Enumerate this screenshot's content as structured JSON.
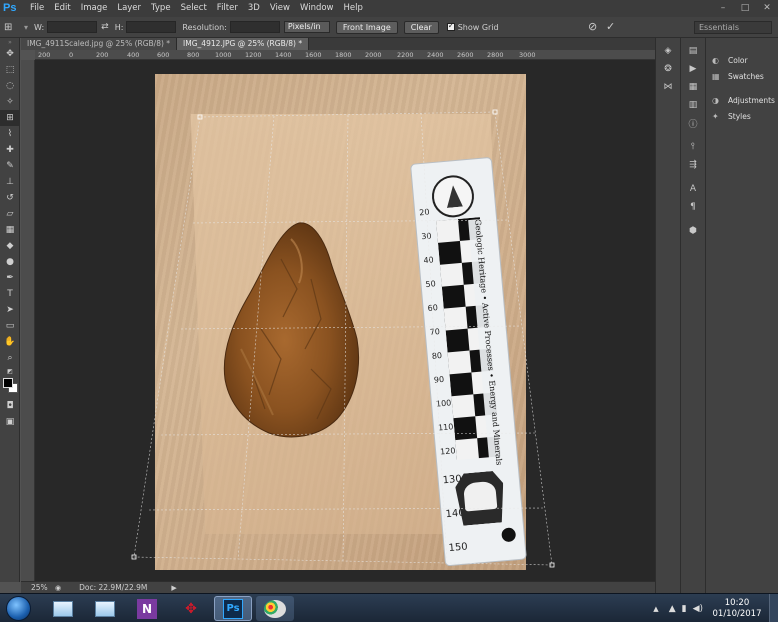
{
  "app": {
    "logo": "Ps"
  },
  "menu": [
    "File",
    "Edit",
    "Image",
    "Layer",
    "Type",
    "Select",
    "Filter",
    "3D",
    "View",
    "Window",
    "Help"
  ],
  "window_controls": {
    "minimize": "–",
    "maximize": "□",
    "close": "✕"
  },
  "options": {
    "w_label": "W:",
    "h_label": "H:",
    "resolution_label": "Resolution:",
    "units_value": "Pixels/in",
    "front_image_label": "Front Image",
    "clear_label": "Clear",
    "show_grid_label": "Show Grid",
    "show_grid_checked": true,
    "workspace_value": "Essentials"
  },
  "tabs": [
    {
      "label": "IMG_4911Scaled.jpg @ 25% (RGB/8) *",
      "active": false
    },
    {
      "label": "IMG_4912.JPG @ 25% (RGB/8) *",
      "active": true
    }
  ],
  "ruler_ticks": [
    "200",
    "0",
    "200",
    "400",
    "600",
    "800",
    "1000",
    "1200",
    "1400",
    "1600",
    "1800",
    "2000",
    "2200",
    "2400",
    "2600",
    "2800",
    "3000"
  ],
  "status": {
    "zoom": "25%",
    "doc_info": "Doc: 22.9M/22.9M"
  },
  "panels": [
    {
      "label": "Color",
      "icon": "color-icon"
    },
    {
      "label": "Swatches",
      "icon": "swatches-icon"
    },
    {
      "label": "Adjustments",
      "icon": "adjustments-icon"
    },
    {
      "label": "Styles",
      "icon": "styles-icon"
    }
  ],
  "photo": {
    "ruler_text": "Geologic Heritage • Active Processes • Energy and Minerals",
    "ruler_numbers": [
      "20",
      "30",
      "40",
      "50",
      "60",
      "70",
      "80",
      "90",
      "100",
      "110",
      "120",
      "130",
      "140",
      "150"
    ]
  },
  "taskbar": {
    "apps": [
      "explorer-icon",
      "explorer-icon",
      "onenote-icon",
      "mendeley-icon",
      "photoshop-icon",
      "paint-icon"
    ],
    "time": "10:20",
    "date": "01/10/2017"
  },
  "colors": {
    "accent": "#30a8ff",
    "workspace_bg": "#282828",
    "chrome": "#424242"
  }
}
